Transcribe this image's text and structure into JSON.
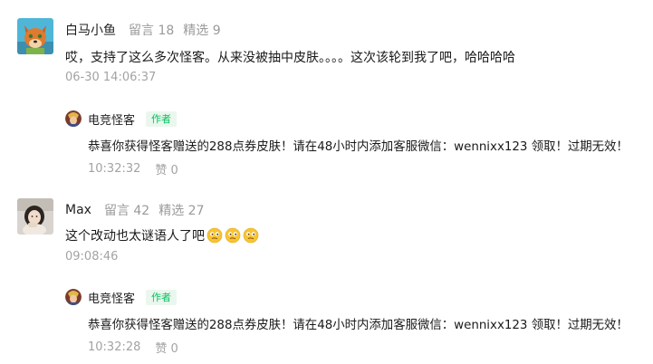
{
  "comments": [
    {
      "avatar_icon": "fox-avatar-icon",
      "nickname": "白马小鱼",
      "messages": "留言 18",
      "featured": "精选 9",
      "text": "哎，支持了这么多次怪客。从来没被抽中皮肤。。。。这次该轮到我了吧，哈哈哈哈",
      "time": "06-30 14:06:37",
      "reply": {
        "avatar_icon": "hero-avatar-icon",
        "name": "电竞怪客",
        "badge": "作者",
        "text": "恭喜你获得怪客赠送的288点券皮肤！请在48小时内添加客服微信：wennixx123 领取！过期无效！",
        "time": "10:32:32",
        "likes": "赞 0"
      }
    },
    {
      "avatar_icon": "girl-photo-avatar-icon",
      "nickname": "Max",
      "messages": "留言 42",
      "featured": "精选 27",
      "text": "这个改动也太谜语人了吧",
      "emojis": [
        "thinking-face-emoji",
        "thinking-face-emoji",
        "thinking-face-emoji"
      ],
      "time": "09:08:46",
      "reply": {
        "avatar_icon": "hero-avatar-icon",
        "name": "电竞怪客",
        "badge": "作者",
        "text": "恭喜你获得怪客赠送的288点券皮肤！请在48小时内添加客服微信：wennixx123 领取！过期无效！",
        "time": "10:32:28",
        "likes": "赞 0"
      }
    }
  ]
}
